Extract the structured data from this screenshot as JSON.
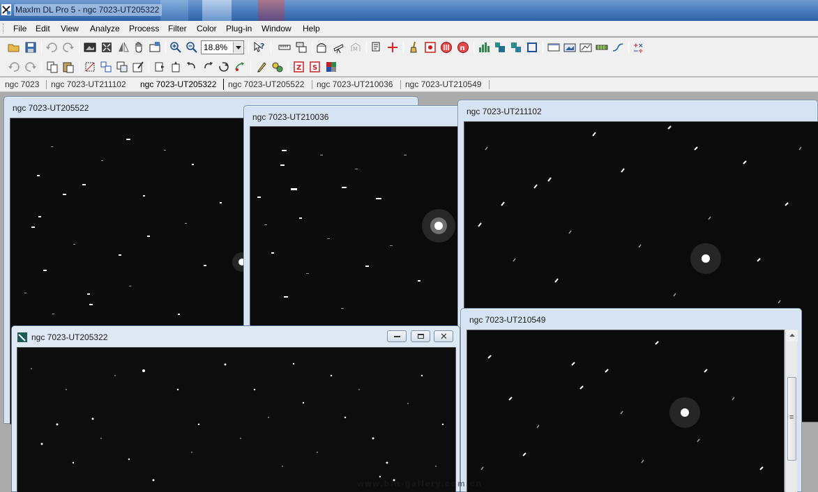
{
  "window": {
    "title": "MaxIm DL Pro 5 - ngc 7023-UT205322"
  },
  "menu": [
    "File",
    "Edit",
    "View",
    "Analyze",
    "Process",
    "Filter",
    "Color",
    "Plug-in",
    "Window",
    "Help"
  ],
  "toolbar": {
    "zoom_value": "18.8%"
  },
  "tabs": [
    "ngc 7023",
    "ngc 7023-UT211102",
    "ngc 7023-UT205322",
    "ngc 7023-UT205522",
    "ngc 7023-UT210036",
    "ngc 7023-UT210549"
  ],
  "active_tab": "ngc 7023-UT205322",
  "windows": {
    "w205522": {
      "title": "ngc 7023-UT205522"
    },
    "w210036": {
      "title": "ngc 7023-UT210036"
    },
    "w211102": {
      "title": "ngc 7023-UT211102"
    },
    "w210549": {
      "title": "ngc 7023-UT210549"
    },
    "w205322": {
      "title": "ngc 7023-UT205322"
    }
  },
  "colors": {
    "title_bar": "#4e7fbf",
    "mdi_background": "#ababab",
    "sky": "#0a0a0a"
  },
  "watermark": "www.bin-gallery.com.cn"
}
